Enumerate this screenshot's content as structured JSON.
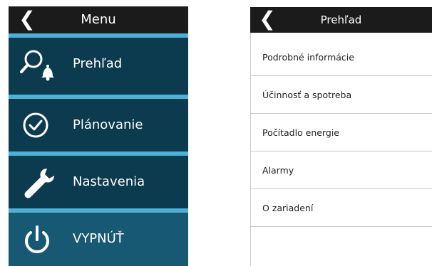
{
  "left_panel": {
    "title": "Menu",
    "back_glyph": "❮",
    "items": [
      {
        "label": "Prehľad",
        "icon": "search-bell-icon"
      },
      {
        "label": "Plánovanie",
        "icon": "clock-icon"
      },
      {
        "label": "Nastavenia",
        "icon": "wrench-icon"
      },
      {
        "label": "VYPNÚŤ",
        "icon": "power-icon"
      }
    ]
  },
  "right_panel": {
    "title": "Prehľad",
    "back_glyph": "❮",
    "items": [
      {
        "label": "Podrobné informácie"
      },
      {
        "label": "Účinnosť a spotreba"
      },
      {
        "label": "Počítadlo energie"
      },
      {
        "label": "Alarmy"
      },
      {
        "label": "O zariadení"
      }
    ]
  },
  "colors": {
    "header": "#1b1b1b",
    "menu_bg": "#0c3a4e",
    "menu_off_bg": "#175873",
    "separator": "#4ab2d6",
    "list_border": "#c9c9c9"
  }
}
